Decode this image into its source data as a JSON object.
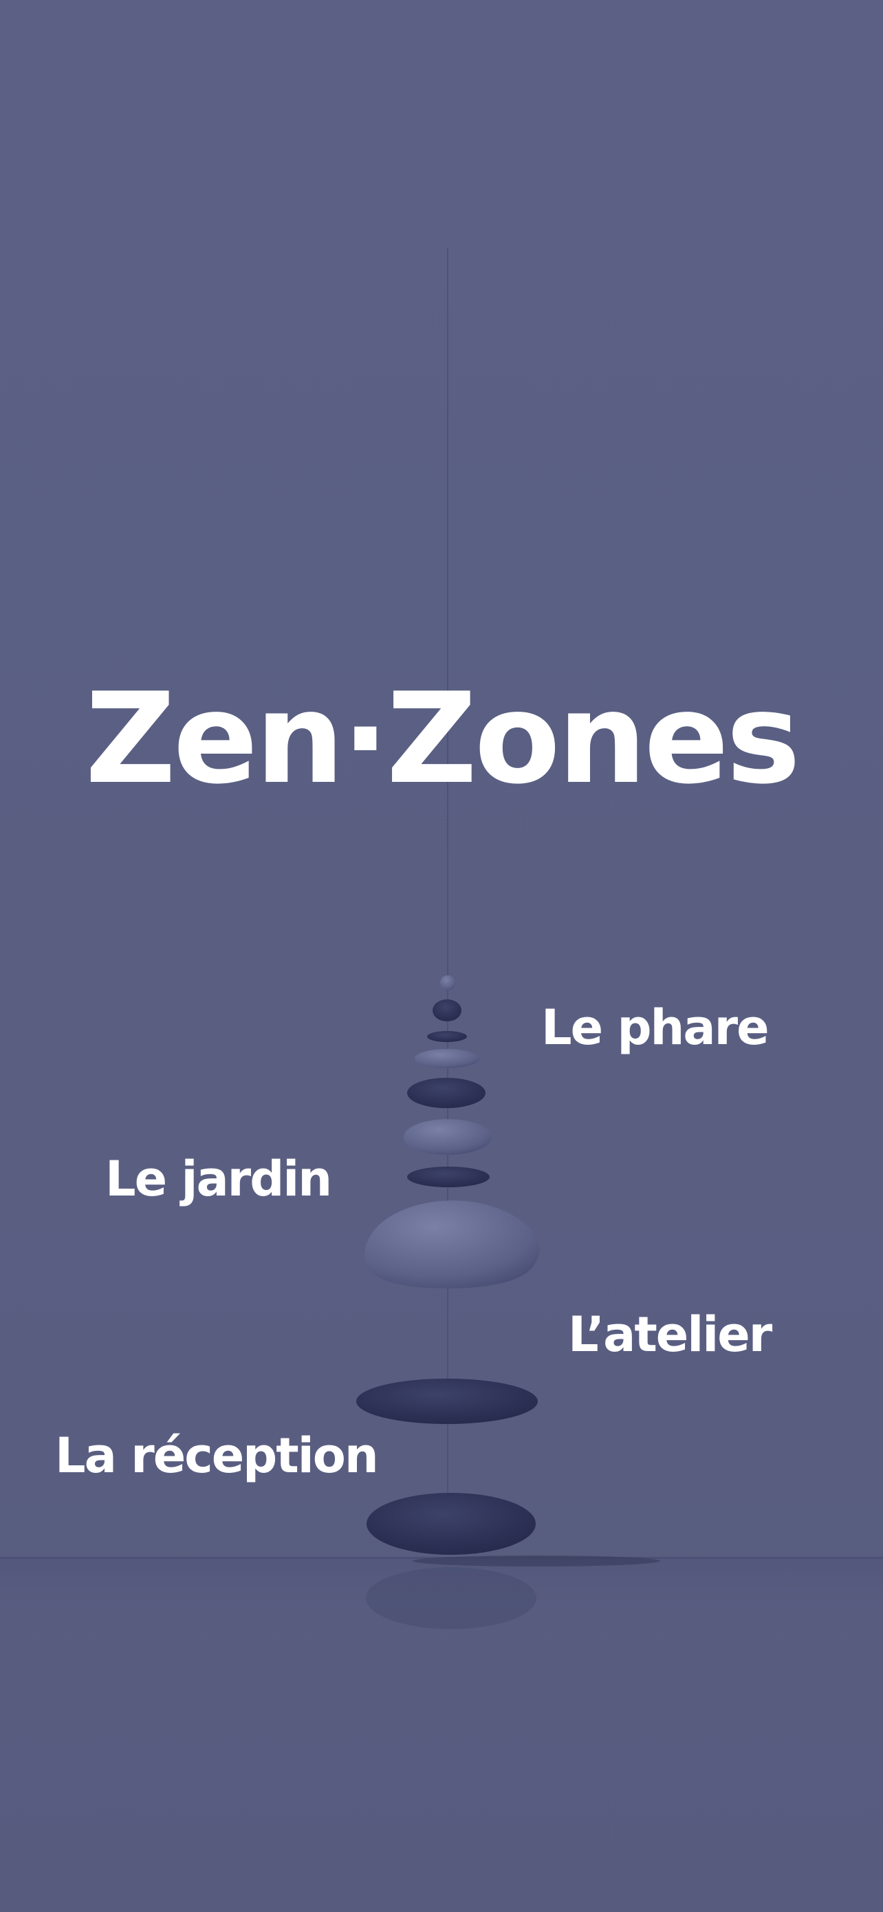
{
  "app": {
    "title": "Zen·Zones"
  },
  "zones": [
    {
      "id": "phare",
      "label": "Le phare"
    },
    {
      "id": "jardin",
      "label": "Le jardin"
    },
    {
      "id": "atelier",
      "label": "L’atelier"
    },
    {
      "id": "reception",
      "label": "La réception"
    }
  ],
  "colors": {
    "background": "#5b6084",
    "stone_dark": "#2c3054",
    "stone_light": "#6b7096",
    "text": "#ffffff"
  },
  "illustration": {
    "name": "hanging-stones-mobile"
  }
}
